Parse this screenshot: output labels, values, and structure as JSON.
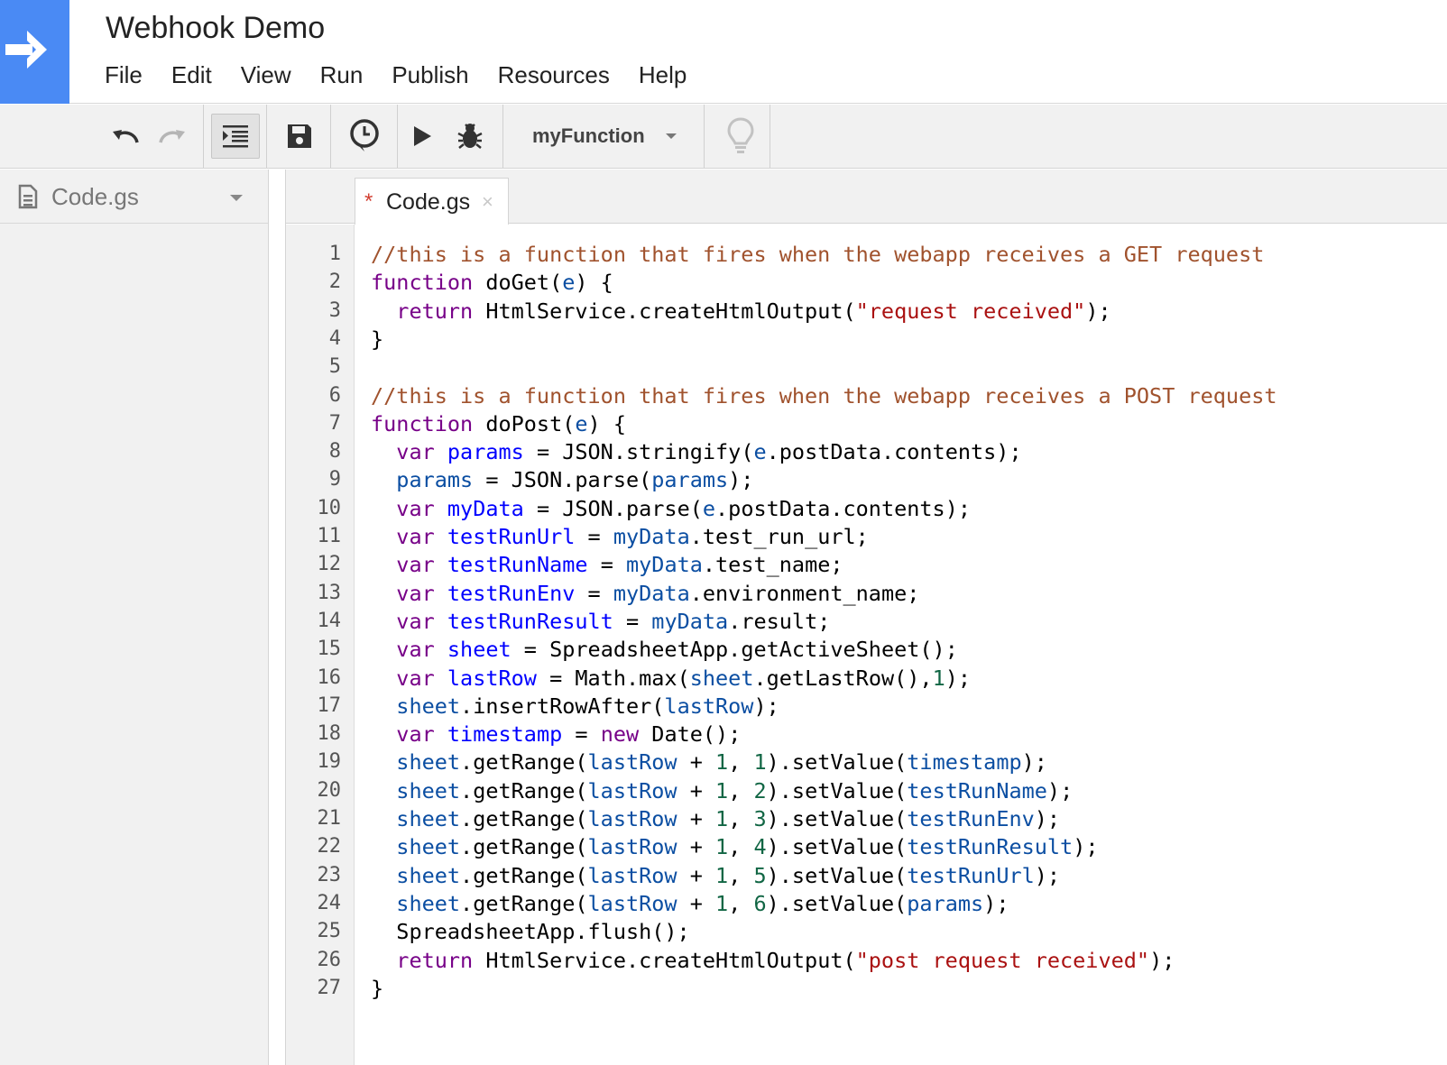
{
  "header": {
    "title": "Webhook Demo",
    "menu": [
      "File",
      "Edit",
      "View",
      "Run",
      "Publish",
      "Resources",
      "Help"
    ]
  },
  "toolbar": {
    "function_select": "myFunction"
  },
  "sidebar": {
    "files": [
      {
        "name": "Code.gs"
      }
    ]
  },
  "editor": {
    "tab_name": "Code.gs",
    "tab_modified_marker": "*",
    "tab_close": "×",
    "lines": [
      [
        [
          "c",
          "//this is a function that fires when the webapp receives a GET request"
        ]
      ],
      [
        [
          "k",
          "function"
        ],
        [
          "p",
          " doGet("
        ],
        [
          "v",
          "e"
        ],
        [
          "p",
          ") {"
        ]
      ],
      [
        [
          "p",
          "  "
        ],
        [
          "k",
          "return"
        ],
        [
          "p",
          " HtmlService.createHtmlOutput("
        ],
        [
          "s",
          "\"request received\""
        ],
        [
          "p",
          ");"
        ]
      ],
      [
        [
          "p",
          "}"
        ]
      ],
      [
        [
          "p",
          ""
        ]
      ],
      [
        [
          "c",
          "//this is a function that fires when the webapp receives a POST request"
        ]
      ],
      [
        [
          "k",
          "function"
        ],
        [
          "p",
          " doPost("
        ],
        [
          "v",
          "e"
        ],
        [
          "p",
          ") {"
        ]
      ],
      [
        [
          "p",
          "  "
        ],
        [
          "k",
          "var"
        ],
        [
          "p",
          " "
        ],
        [
          "d",
          "params"
        ],
        [
          "p",
          " = JSON.stringify("
        ],
        [
          "v",
          "e"
        ],
        [
          "p",
          ".postData.contents);"
        ]
      ],
      [
        [
          "p",
          "  "
        ],
        [
          "v",
          "params"
        ],
        [
          "p",
          " = JSON.parse("
        ],
        [
          "v",
          "params"
        ],
        [
          "p",
          ");"
        ]
      ],
      [
        [
          "p",
          "  "
        ],
        [
          "k",
          "var"
        ],
        [
          "p",
          " "
        ],
        [
          "d",
          "myData"
        ],
        [
          "p",
          " = JSON.parse("
        ],
        [
          "v",
          "e"
        ],
        [
          "p",
          ".postData.contents);"
        ]
      ],
      [
        [
          "p",
          "  "
        ],
        [
          "k",
          "var"
        ],
        [
          "p",
          " "
        ],
        [
          "d",
          "testRunUrl"
        ],
        [
          "p",
          " = "
        ],
        [
          "v",
          "myData"
        ],
        [
          "p",
          ".test_run_url;"
        ]
      ],
      [
        [
          "p",
          "  "
        ],
        [
          "k",
          "var"
        ],
        [
          "p",
          " "
        ],
        [
          "d",
          "testRunName"
        ],
        [
          "p",
          " = "
        ],
        [
          "v",
          "myData"
        ],
        [
          "p",
          ".test_name;"
        ]
      ],
      [
        [
          "p",
          "  "
        ],
        [
          "k",
          "var"
        ],
        [
          "p",
          " "
        ],
        [
          "d",
          "testRunEnv"
        ],
        [
          "p",
          " = "
        ],
        [
          "v",
          "myData"
        ],
        [
          "p",
          ".environment_name;"
        ]
      ],
      [
        [
          "p",
          "  "
        ],
        [
          "k",
          "var"
        ],
        [
          "p",
          " "
        ],
        [
          "d",
          "testRunResult"
        ],
        [
          "p",
          " = "
        ],
        [
          "v",
          "myData"
        ],
        [
          "p",
          ".result;"
        ]
      ],
      [
        [
          "p",
          "  "
        ],
        [
          "k",
          "var"
        ],
        [
          "p",
          " "
        ],
        [
          "d",
          "sheet"
        ],
        [
          "p",
          " = SpreadsheetApp.getActiveSheet();"
        ]
      ],
      [
        [
          "p",
          "  "
        ],
        [
          "k",
          "var"
        ],
        [
          "p",
          " "
        ],
        [
          "d",
          "lastRow"
        ],
        [
          "p",
          " = Math.max("
        ],
        [
          "v",
          "sheet"
        ],
        [
          "p",
          ".getLastRow(),"
        ],
        [
          "n",
          "1"
        ],
        [
          "p",
          ");"
        ]
      ],
      [
        [
          "p",
          "  "
        ],
        [
          "v",
          "sheet"
        ],
        [
          "p",
          ".insertRowAfter("
        ],
        [
          "v",
          "lastRow"
        ],
        [
          "p",
          ");"
        ]
      ],
      [
        [
          "p",
          "  "
        ],
        [
          "k",
          "var"
        ],
        [
          "p",
          " "
        ],
        [
          "d",
          "timestamp"
        ],
        [
          "p",
          " = "
        ],
        [
          "k",
          "new"
        ],
        [
          "p",
          " Date();"
        ]
      ],
      [
        [
          "p",
          "  "
        ],
        [
          "v",
          "sheet"
        ],
        [
          "p",
          ".getRange("
        ],
        [
          "v",
          "lastRow"
        ],
        [
          "p",
          " + "
        ],
        [
          "n",
          "1"
        ],
        [
          "p",
          ", "
        ],
        [
          "n",
          "1"
        ],
        [
          "p",
          ").setValue("
        ],
        [
          "v",
          "timestamp"
        ],
        [
          "p",
          ");"
        ]
      ],
      [
        [
          "p",
          "  "
        ],
        [
          "v",
          "sheet"
        ],
        [
          "p",
          ".getRange("
        ],
        [
          "v",
          "lastRow"
        ],
        [
          "p",
          " + "
        ],
        [
          "n",
          "1"
        ],
        [
          "p",
          ", "
        ],
        [
          "n",
          "2"
        ],
        [
          "p",
          ").setValue("
        ],
        [
          "v",
          "testRunName"
        ],
        [
          "p",
          ");"
        ]
      ],
      [
        [
          "p",
          "  "
        ],
        [
          "v",
          "sheet"
        ],
        [
          "p",
          ".getRange("
        ],
        [
          "v",
          "lastRow"
        ],
        [
          "p",
          " + "
        ],
        [
          "n",
          "1"
        ],
        [
          "p",
          ", "
        ],
        [
          "n",
          "3"
        ],
        [
          "p",
          ").setValue("
        ],
        [
          "v",
          "testRunEnv"
        ],
        [
          "p",
          ");"
        ]
      ],
      [
        [
          "p",
          "  "
        ],
        [
          "v",
          "sheet"
        ],
        [
          "p",
          ".getRange("
        ],
        [
          "v",
          "lastRow"
        ],
        [
          "p",
          " + "
        ],
        [
          "n",
          "1"
        ],
        [
          "p",
          ", "
        ],
        [
          "n",
          "4"
        ],
        [
          "p",
          ").setValue("
        ],
        [
          "v",
          "testRunResult"
        ],
        [
          "p",
          ");"
        ]
      ],
      [
        [
          "p",
          "  "
        ],
        [
          "v",
          "sheet"
        ],
        [
          "p",
          ".getRange("
        ],
        [
          "v",
          "lastRow"
        ],
        [
          "p",
          " + "
        ],
        [
          "n",
          "1"
        ],
        [
          "p",
          ", "
        ],
        [
          "n",
          "5"
        ],
        [
          "p",
          ").setValue("
        ],
        [
          "v",
          "testRunUrl"
        ],
        [
          "p",
          ");"
        ]
      ],
      [
        [
          "p",
          "  "
        ],
        [
          "v",
          "sheet"
        ],
        [
          "p",
          ".getRange("
        ],
        [
          "v",
          "lastRow"
        ],
        [
          "p",
          " + "
        ],
        [
          "n",
          "1"
        ],
        [
          "p",
          ", "
        ],
        [
          "n",
          "6"
        ],
        [
          "p",
          ").setValue("
        ],
        [
          "v",
          "params"
        ],
        [
          "p",
          ");"
        ]
      ],
      [
        [
          "p",
          "  SpreadsheetApp.flush();"
        ]
      ],
      [
        [
          "p",
          "  "
        ],
        [
          "k",
          "return"
        ],
        [
          "p",
          " HtmlService.createHtmlOutput("
        ],
        [
          "s",
          "\"post request received\""
        ],
        [
          "p",
          ");"
        ]
      ],
      [
        [
          "p",
          "}"
        ]
      ]
    ]
  }
}
